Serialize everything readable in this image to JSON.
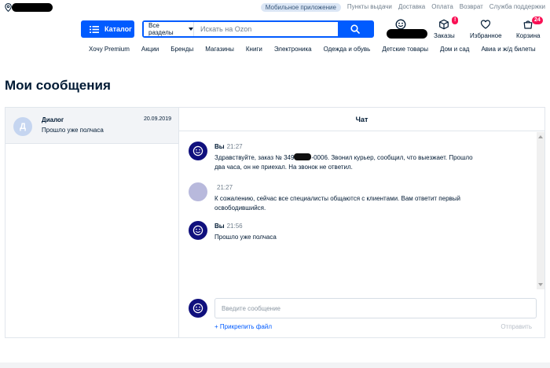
{
  "topbar": {
    "links": [
      "Мобильное приложение",
      "Пункты выдачи",
      "Доставка",
      "Оплата",
      "Возврат",
      "Служба поддержки"
    ]
  },
  "header": {
    "catalog_label": "Каталог",
    "search_category": "Все разделы",
    "search_placeholder": "Искать на Ozon",
    "orders_label": "Заказы",
    "orders_badge": "!",
    "favorites_label": "Избранное",
    "cart_label": "Корзина",
    "cart_badge": "24"
  },
  "nav": {
    "items": [
      "Хочу Premium",
      "Акции",
      "Бренды",
      "Магазины",
      "Книги",
      "Электроника",
      "Одежда и обувь",
      "Детские товары",
      "Дом и сад",
      "Авиа и ж/д билеты"
    ]
  },
  "page": {
    "title": "Мои сообщения"
  },
  "dialogs": {
    "items": [
      {
        "avatar_letter": "Д",
        "name": "Диалог",
        "date": "20.09.2019",
        "preview": "Прошло уже полчаса"
      }
    ]
  },
  "chat": {
    "title": "Чат",
    "messages": [
      {
        "author": "Вы",
        "time": "21:27",
        "text_before": "Здравствуйте, заказ № 349",
        "text_after": "-0006. Звонил курьер, сообщил, что выезжает. Прошло два часа, он не приехал. На звонок не ответил."
      },
      {
        "author": "",
        "time": "21:27",
        "text": "К сожалению, сейчас все специалисты общаются с клиентами. Вам ответит первый освободившийся."
      },
      {
        "author": "Вы",
        "time": "21:56",
        "text": "Прошло уже полчаса"
      }
    ],
    "compose_placeholder": "Введите сообщение",
    "attach_label": "+ Прикрепить файл",
    "send_label": "Отправить"
  },
  "colors": {
    "accent": "#005bff",
    "badge": "#f91155",
    "avatar": "#10107d"
  }
}
